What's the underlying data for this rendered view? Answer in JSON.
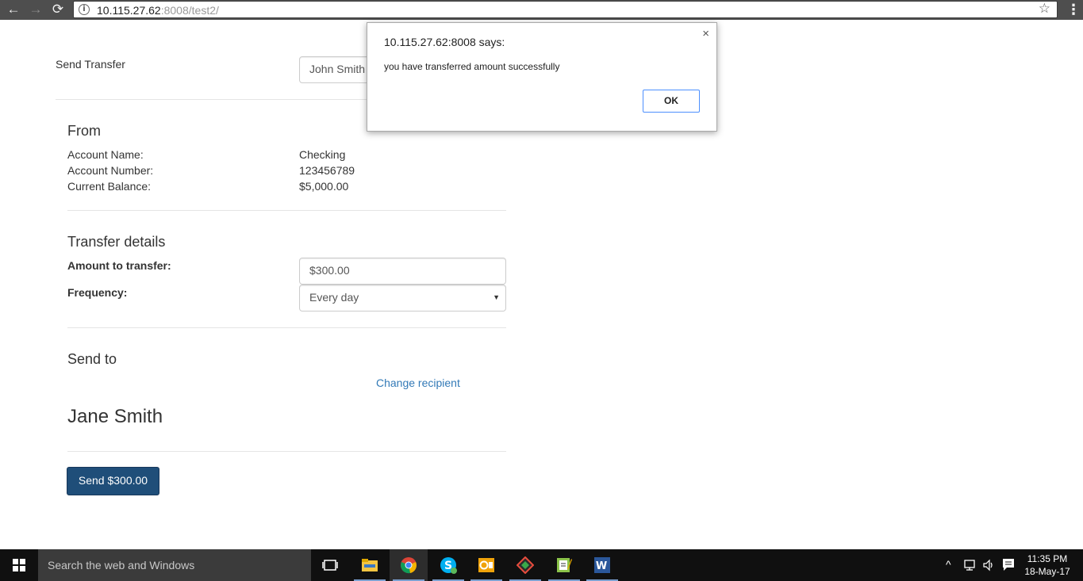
{
  "browser": {
    "url_host": "10.115.27.62",
    "url_path": ":8008/test2/",
    "back_icon": "←",
    "forward_icon": "→",
    "reload_icon": "⟳",
    "info_icon": "i",
    "star_icon": "☆",
    "menu_icon": "⋮"
  },
  "header": {
    "title": "Send Transfer",
    "account_select": "John Smith"
  },
  "from": {
    "title": "From",
    "rows": [
      {
        "label": "Account Name:",
        "value": "Checking"
      },
      {
        "label": "Account Number:",
        "value": "123456789"
      },
      {
        "label": "Current Balance:",
        "value": "$5,000.00"
      }
    ]
  },
  "transfer": {
    "title": "Transfer details",
    "amount_label": "Amount to transfer:",
    "amount_value": "$300.00",
    "frequency_label": "Frequency:",
    "frequency_value": "Every day",
    "caret": "▼"
  },
  "send_to": {
    "title": "Send to",
    "change_link": "Change recipient",
    "recipient_name": "Jane Smith"
  },
  "send_button": "Send $300.00",
  "dialog": {
    "title": "10.115.27.62:8008 says:",
    "message": "you have transferred amount successfully",
    "ok_label": "OK",
    "close_icon": "×"
  },
  "taskbar": {
    "search_placeholder": "Search the web and Windows",
    "time": "11:35 PM",
    "date": "18-May-17",
    "tray_chevron": "^"
  },
  "colors": {
    "primary_button": "#1f4e79",
    "link": "#337ab7",
    "chrome_toolbar": "#4e4e4e",
    "taskbar": "#101010"
  }
}
